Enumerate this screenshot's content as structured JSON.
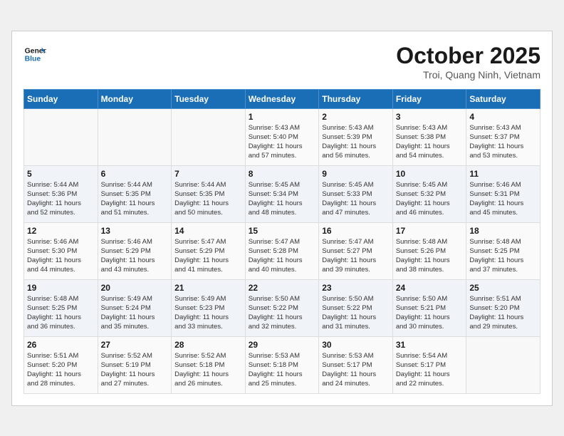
{
  "header": {
    "logo_line1": "General",
    "logo_line2": "Blue",
    "month_title": "October 2025",
    "location": "Troi, Quang Ninh, Vietnam"
  },
  "weekdays": [
    "Sunday",
    "Monday",
    "Tuesday",
    "Wednesday",
    "Thursday",
    "Friday",
    "Saturday"
  ],
  "weeks": [
    [
      {
        "day": "",
        "info": ""
      },
      {
        "day": "",
        "info": ""
      },
      {
        "day": "",
        "info": ""
      },
      {
        "day": "1",
        "info": "Sunrise: 5:43 AM\nSunset: 5:40 PM\nDaylight: 11 hours\nand 57 minutes."
      },
      {
        "day": "2",
        "info": "Sunrise: 5:43 AM\nSunset: 5:39 PM\nDaylight: 11 hours\nand 56 minutes."
      },
      {
        "day": "3",
        "info": "Sunrise: 5:43 AM\nSunset: 5:38 PM\nDaylight: 11 hours\nand 54 minutes."
      },
      {
        "day": "4",
        "info": "Sunrise: 5:43 AM\nSunset: 5:37 PM\nDaylight: 11 hours\nand 53 minutes."
      }
    ],
    [
      {
        "day": "5",
        "info": "Sunrise: 5:44 AM\nSunset: 5:36 PM\nDaylight: 11 hours\nand 52 minutes."
      },
      {
        "day": "6",
        "info": "Sunrise: 5:44 AM\nSunset: 5:35 PM\nDaylight: 11 hours\nand 51 minutes."
      },
      {
        "day": "7",
        "info": "Sunrise: 5:44 AM\nSunset: 5:35 PM\nDaylight: 11 hours\nand 50 minutes."
      },
      {
        "day": "8",
        "info": "Sunrise: 5:45 AM\nSunset: 5:34 PM\nDaylight: 11 hours\nand 48 minutes."
      },
      {
        "day": "9",
        "info": "Sunrise: 5:45 AM\nSunset: 5:33 PM\nDaylight: 11 hours\nand 47 minutes."
      },
      {
        "day": "10",
        "info": "Sunrise: 5:45 AM\nSunset: 5:32 PM\nDaylight: 11 hours\nand 46 minutes."
      },
      {
        "day": "11",
        "info": "Sunrise: 5:46 AM\nSunset: 5:31 PM\nDaylight: 11 hours\nand 45 minutes."
      }
    ],
    [
      {
        "day": "12",
        "info": "Sunrise: 5:46 AM\nSunset: 5:30 PM\nDaylight: 11 hours\nand 44 minutes."
      },
      {
        "day": "13",
        "info": "Sunrise: 5:46 AM\nSunset: 5:29 PM\nDaylight: 11 hours\nand 43 minutes."
      },
      {
        "day": "14",
        "info": "Sunrise: 5:47 AM\nSunset: 5:29 PM\nDaylight: 11 hours\nand 41 minutes."
      },
      {
        "day": "15",
        "info": "Sunrise: 5:47 AM\nSunset: 5:28 PM\nDaylight: 11 hours\nand 40 minutes."
      },
      {
        "day": "16",
        "info": "Sunrise: 5:47 AM\nSunset: 5:27 PM\nDaylight: 11 hours\nand 39 minutes."
      },
      {
        "day": "17",
        "info": "Sunrise: 5:48 AM\nSunset: 5:26 PM\nDaylight: 11 hours\nand 38 minutes."
      },
      {
        "day": "18",
        "info": "Sunrise: 5:48 AM\nSunset: 5:25 PM\nDaylight: 11 hours\nand 37 minutes."
      }
    ],
    [
      {
        "day": "19",
        "info": "Sunrise: 5:48 AM\nSunset: 5:25 PM\nDaylight: 11 hours\nand 36 minutes."
      },
      {
        "day": "20",
        "info": "Sunrise: 5:49 AM\nSunset: 5:24 PM\nDaylight: 11 hours\nand 35 minutes."
      },
      {
        "day": "21",
        "info": "Sunrise: 5:49 AM\nSunset: 5:23 PM\nDaylight: 11 hours\nand 33 minutes."
      },
      {
        "day": "22",
        "info": "Sunrise: 5:50 AM\nSunset: 5:22 PM\nDaylight: 11 hours\nand 32 minutes."
      },
      {
        "day": "23",
        "info": "Sunrise: 5:50 AM\nSunset: 5:22 PM\nDaylight: 11 hours\nand 31 minutes."
      },
      {
        "day": "24",
        "info": "Sunrise: 5:50 AM\nSunset: 5:21 PM\nDaylight: 11 hours\nand 30 minutes."
      },
      {
        "day": "25",
        "info": "Sunrise: 5:51 AM\nSunset: 5:20 PM\nDaylight: 11 hours\nand 29 minutes."
      }
    ],
    [
      {
        "day": "26",
        "info": "Sunrise: 5:51 AM\nSunset: 5:20 PM\nDaylight: 11 hours\nand 28 minutes."
      },
      {
        "day": "27",
        "info": "Sunrise: 5:52 AM\nSunset: 5:19 PM\nDaylight: 11 hours\nand 27 minutes."
      },
      {
        "day": "28",
        "info": "Sunrise: 5:52 AM\nSunset: 5:18 PM\nDaylight: 11 hours\nand 26 minutes."
      },
      {
        "day": "29",
        "info": "Sunrise: 5:53 AM\nSunset: 5:18 PM\nDaylight: 11 hours\nand 25 minutes."
      },
      {
        "day": "30",
        "info": "Sunrise: 5:53 AM\nSunset: 5:17 PM\nDaylight: 11 hours\nand 24 minutes."
      },
      {
        "day": "31",
        "info": "Sunrise: 5:54 AM\nSunset: 5:17 PM\nDaylight: 11 hours\nand 22 minutes."
      },
      {
        "day": "",
        "info": ""
      }
    ]
  ]
}
